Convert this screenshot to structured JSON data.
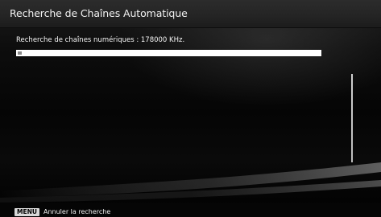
{
  "header": {
    "title": "Recherche de Chaînes Automatique"
  },
  "search": {
    "status_text": "Recherche de chaînes numériques : 178000 KHz.",
    "progress_fraction": 0.01
  },
  "footer": {
    "key_label": "MENU",
    "hint_text": "Annuler la recherche"
  },
  "colors": {
    "header_bg": "#2a2a2a",
    "progress_track": "#ffffff",
    "progress_fill": "#8a8a8a",
    "menu_key_bg": "#d9d9d9"
  }
}
